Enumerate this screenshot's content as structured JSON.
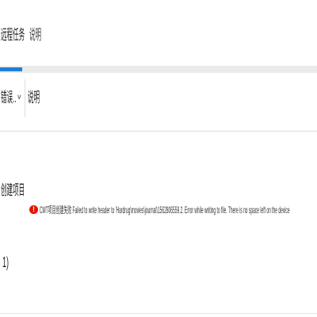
{
  "tabs": [
    {
      "label": "远程任务"
    },
    {
      "label": "说明"
    }
  ],
  "header": {
    "filter_value": "错误..",
    "description_column": "说明"
  },
  "entry": {
    "project_line1": "创建项目",
    "project_line2": "1)",
    "severity_icon": "error-icon",
    "message": "CMT项目创建失败 Failed to write header to 'Hardrug\\movies\\journal\\1562806559.2. Error while writing to file. There is no space left on the device"
  },
  "colors": {
    "accent": "#1f7fd8",
    "error": "#e51400"
  }
}
